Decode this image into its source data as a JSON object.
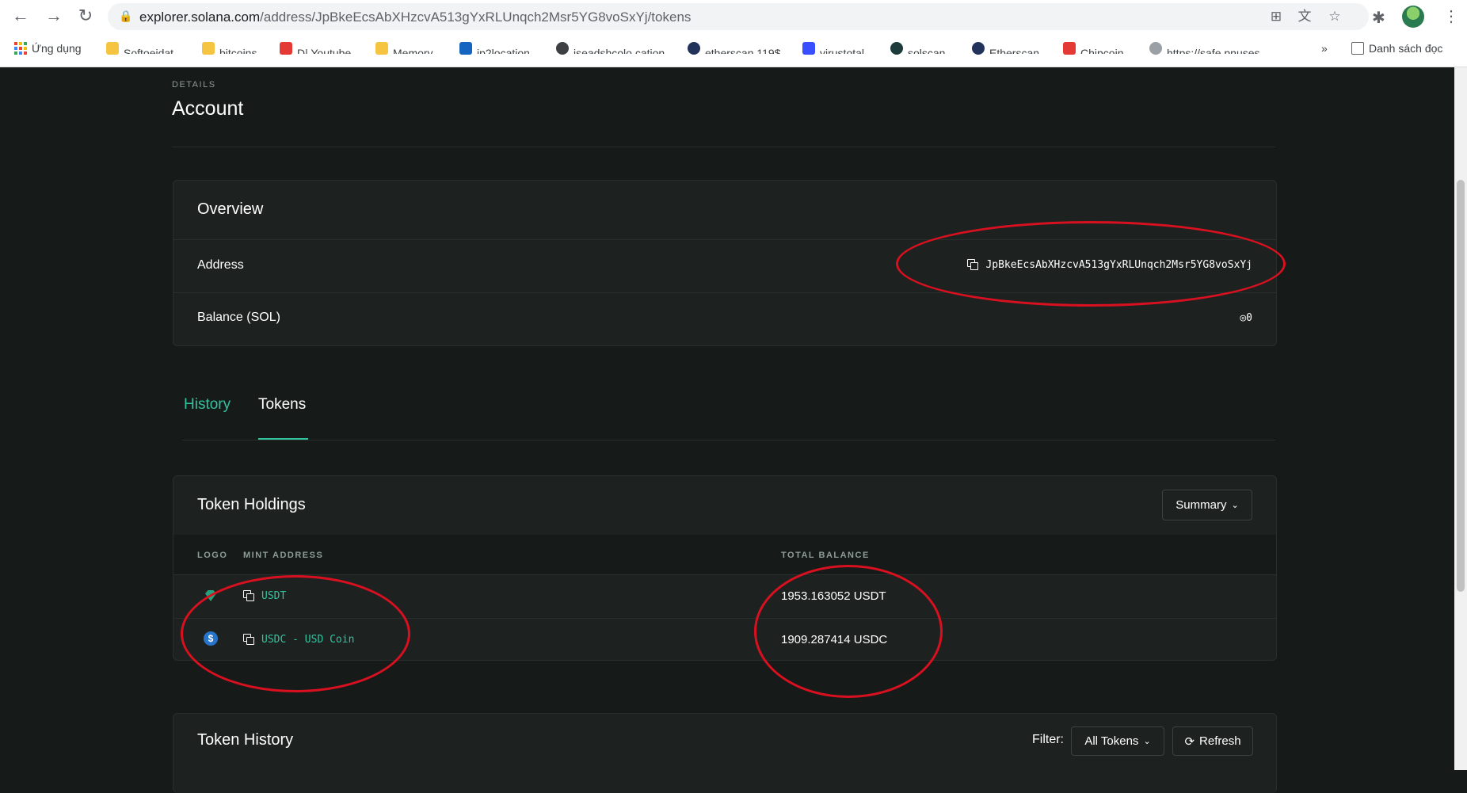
{
  "browser": {
    "url_domain": "explorer.solana.com",
    "url_path": "/address/JpBkeEcsAbXHzcvA513gYxRLUnqch2Msr5YG8voSxYj/tokens",
    "bookmarks": [
      {
        "label": "Ứng dụng",
        "icon": "apps-grid-icon"
      },
      {
        "label": "Softoeidat",
        "icon": "folder-icon"
      },
      {
        "label": "bitcoins",
        "icon": "folder-icon"
      },
      {
        "label": "D| Youtube",
        "icon": "youtube-icon"
      },
      {
        "label": "Memory",
        "icon": "folder-icon"
      },
      {
        "label": "ip2location",
        "icon": "ip-icon"
      },
      {
        "label": "iseadshcolo.cation",
        "icon": "globe-icon"
      },
      {
        "label": "etherscan 119$",
        "icon": "etherscan-icon"
      },
      {
        "label": "virustotal",
        "icon": "virustotal-icon"
      },
      {
        "label": "solscan",
        "icon": "solscan-icon"
      },
      {
        "label": "Etherscan",
        "icon": "etherscan-icon"
      },
      {
        "label": "Chipcoin",
        "icon": "youtube-icon"
      },
      {
        "label": "https://safe.pnuses",
        "icon": "globe-icon"
      }
    ],
    "more_bookmarks": "»",
    "reading_list": "Danh sách đọc"
  },
  "page": {
    "details_pretitle": "DETAILS",
    "details_title": "Account"
  },
  "overview": {
    "title": "Overview",
    "address_label": "Address",
    "address_value": "JpBkeEcsAbXHzcvA513gYxRLUnqch2Msr5YG8voSxYj",
    "balance_label": "Balance (SOL)",
    "balance_value": "◎0"
  },
  "tabs": [
    {
      "label": "History",
      "active": false
    },
    {
      "label": "Tokens",
      "active": true
    }
  ],
  "token_holdings": {
    "title": "Token Holdings",
    "summary_button": "Summary",
    "columns": {
      "logo": "LOGO",
      "mint": "MINT ADDRESS",
      "balance": "TOTAL BALANCE"
    },
    "rows": [
      {
        "logo": "usdt-logo-icon",
        "mint": "USDT",
        "balance": "1953.163052 USDT"
      },
      {
        "logo": "usdc-logo-icon",
        "mint": "USDC - USD Coin",
        "balance": "1909.287414 USDC"
      }
    ]
  },
  "token_history": {
    "title": "Token History",
    "filter_label": "Filter:",
    "filter_value": "All Tokens",
    "refresh_button": "Refresh"
  },
  "colors": {
    "accent": "#33c29f",
    "background": "#161a19",
    "card": "#1d2221",
    "annotation_red": "#d8101f"
  }
}
